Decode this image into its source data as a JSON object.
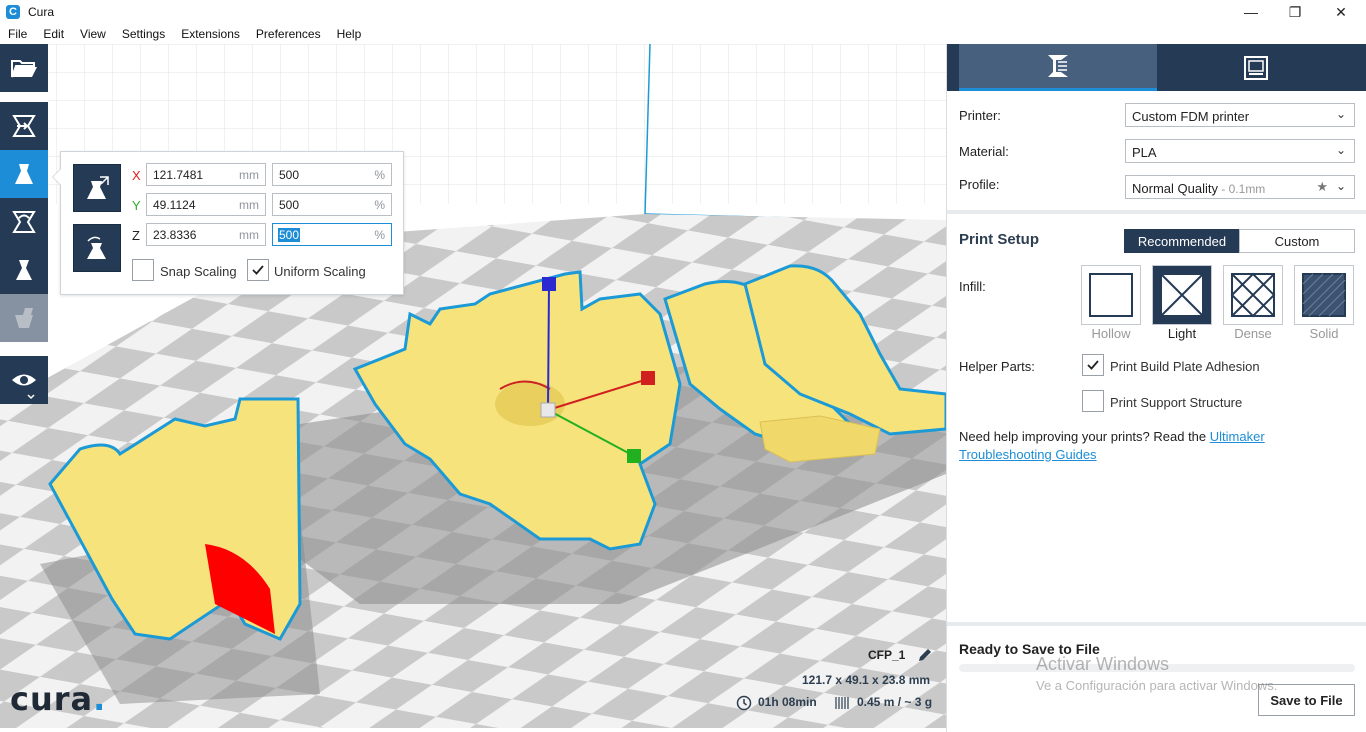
{
  "window": {
    "title": "Cura",
    "logo_glyph": "C",
    "controls": {
      "minimize": "—",
      "maximize": "❐",
      "close": "✕"
    }
  },
  "menu": [
    "File",
    "Edit",
    "View",
    "Settings",
    "Extensions",
    "Preferences",
    "Help"
  ],
  "toolbar": {
    "items": [
      {
        "name": "open-file-button",
        "icon": "folder-open-icon"
      },
      {
        "name": "translate-tool-button",
        "icon": "translate-icon"
      },
      {
        "name": "scale-tool-button",
        "icon": "scale-icon",
        "active": true
      },
      {
        "name": "rotate-tool-button",
        "icon": "rotate-icon"
      },
      {
        "name": "mirror-tool-button",
        "icon": "mirror-icon"
      },
      {
        "name": "per-model-settings-button",
        "icon": "per-model-settings-icon",
        "disabled": true
      },
      {
        "name": "view-mode-button",
        "icon": "eye-icon"
      }
    ]
  },
  "scale_panel": {
    "axes": [
      {
        "label": "X",
        "mm": "121.7481",
        "percent": "500",
        "color": "#e02020"
      },
      {
        "label": "Y",
        "mm": "49.1124",
        "percent": "500",
        "color": "#2eaa2e"
      },
      {
        "label": "Z",
        "mm": "23.8336",
        "percent": "500",
        "color": "#222222"
      }
    ],
    "mm_unit": "mm",
    "percent_unit": "%",
    "snap_scaling": {
      "label": "Snap Scaling",
      "checked": false
    },
    "uniform_scaling": {
      "label": "Uniform Scaling",
      "checked": true
    }
  },
  "viewport": {
    "logo": "cura",
    "job_name": "CFP_1",
    "dimensions": "121.7 x 49.1 x 23.8 mm",
    "print_time": "01h 08min",
    "material_usage": "0.45 m / ~ 3 g",
    "model_color": "#f7e37b",
    "outline_color": "#1c9ad6"
  },
  "sidebar": {
    "tabs": [
      {
        "name": "prepare",
        "icon": "print-settings-icon",
        "active": true
      },
      {
        "name": "monitor",
        "icon": "monitor-icon"
      }
    ],
    "printer_label": "Printer:",
    "printer_value": "Custom FDM printer",
    "material_label": "Material:",
    "material_value": "PLA",
    "profile_label": "Profile:",
    "profile_value": "Normal Quality",
    "profile_sub": " - 0.1mm",
    "print_setup_title": "Print Setup",
    "mode_recommended": "Recommended",
    "mode_custom": "Custom",
    "infill_label": "Infill:",
    "infill_options": [
      "Hollow",
      "Light",
      "Dense",
      "Solid"
    ],
    "infill_selected": "Light",
    "helper_label": "Helper Parts:",
    "adhesion_label": "Print Build Plate Adhesion",
    "adhesion_checked": true,
    "support_label": "Print Support Structure",
    "support_checked": false,
    "help_text": "Need help improving your prints? Read the ",
    "help_link": "Ultimaker Troubleshooting Guides",
    "ready_title": "Ready to Save to File",
    "save_button": "Save to File"
  },
  "os_watermark": {
    "line1": "Activar Windows",
    "line2": "Ve a Configuración para activar Windows."
  },
  "colors": {
    "accent": "#1c8dd6",
    "toolbar_bg": "#243a55",
    "tab_active_bg": "#46607e"
  }
}
